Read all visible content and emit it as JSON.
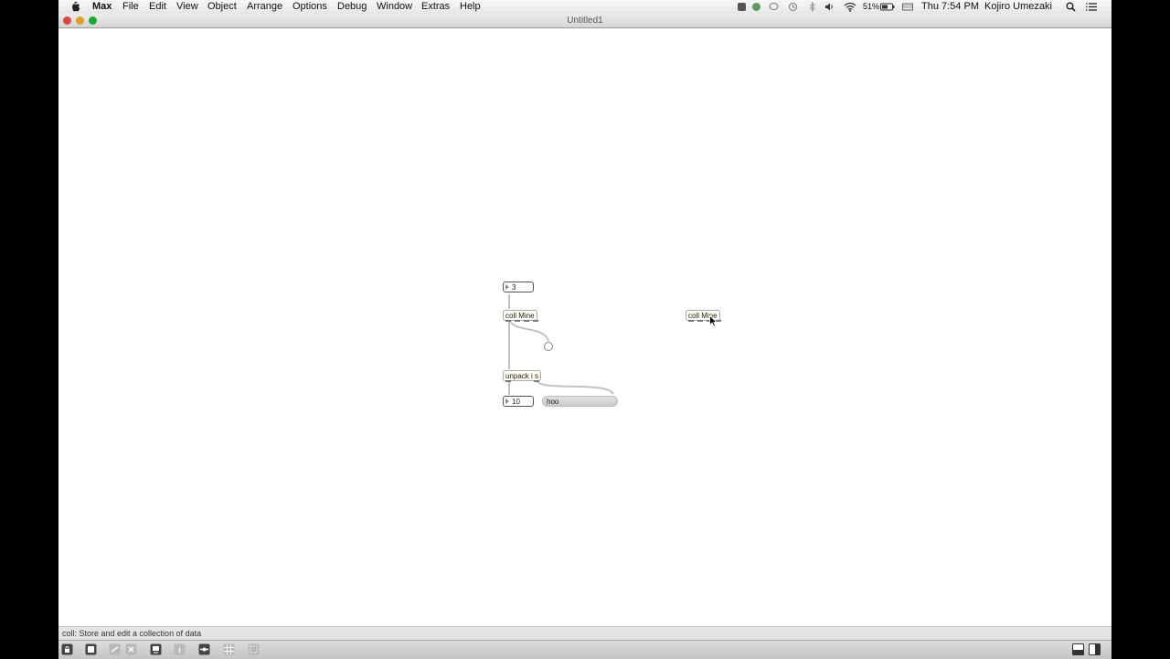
{
  "menubar": {
    "app_name": "Max",
    "items": [
      "File",
      "Edit",
      "View",
      "Object",
      "Arrange",
      "Options",
      "Debug",
      "Window",
      "Extras",
      "Help"
    ],
    "battery": "51%",
    "clock": "Thu 7:54 PM",
    "user": "Kojiro Umezaki"
  },
  "window": {
    "title": "Untitled1"
  },
  "patcher": {
    "number_top": "3",
    "coll_main": "coll Mine",
    "coll_second": "coll Mine",
    "unpack": "unpack i s",
    "number_bottom": "10",
    "message": "hoo"
  },
  "status_bar": {
    "hint": "coll: Store and edit a collection of data"
  },
  "colors": {
    "patch_cord": "#c2c2c2",
    "close": "#e0443e",
    "minimize": "#dea123",
    "zoom": "#1aab29"
  }
}
